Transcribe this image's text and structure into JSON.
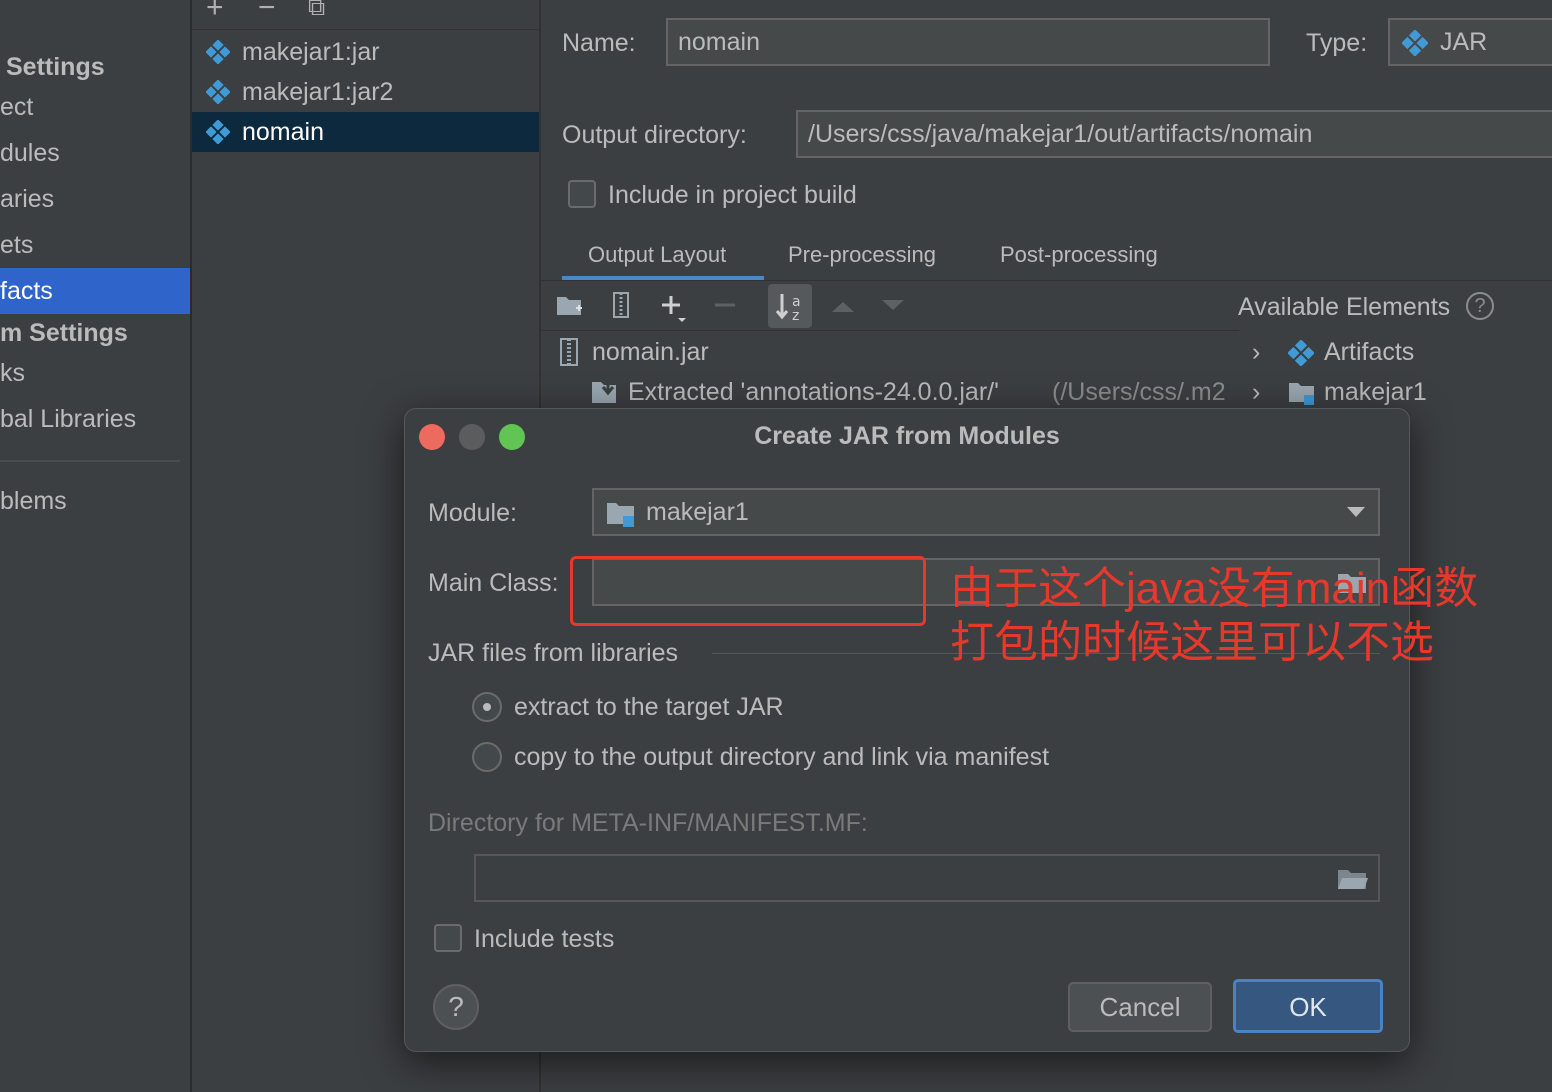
{
  "nav": {
    "items": [
      {
        "label": "Settings"
      },
      {
        "label": "ect"
      },
      {
        "label": "dules"
      },
      {
        "label": "aries"
      },
      {
        "label": "ets"
      },
      {
        "label": "facts"
      },
      {
        "label": "m Settings"
      },
      {
        "label": "ks"
      },
      {
        "label": "bal Libraries"
      },
      {
        "label": "blems"
      }
    ]
  },
  "artifacts": {
    "toolbar": {
      "add": "+",
      "remove": "−",
      "copy": "⧉"
    },
    "items": [
      {
        "label": "makejar1:jar"
      },
      {
        "label": "makejar1:jar2"
      },
      {
        "label": "nomain"
      }
    ]
  },
  "detail": {
    "name_label": "Name:",
    "name_value": "nomain",
    "type_label": "Type:",
    "type_value": "JAR",
    "output_dir_label": "Output directory:",
    "output_dir_value": "/Users/css/java/makejar1/out/artifacts/nomain",
    "include_build_label": "Include in project build",
    "tabs": [
      {
        "label": "Output Layout"
      },
      {
        "label": "Pre-processing"
      },
      {
        "label": "Post-processing"
      }
    ],
    "available_label": "Available Elements",
    "layout_tree": {
      "root": "nomain.jar",
      "child": "Extracted 'annotations-24.0.0.jar/'",
      "child_path": "(/Users/css/.m2"
    },
    "available_tree": [
      {
        "label": "Artifacts"
      },
      {
        "label": "makejar1"
      }
    ]
  },
  "dialog": {
    "title": "Create JAR from Modules",
    "module_label": "Module:",
    "module_value": "makejar1",
    "main_class_label": "Main Class:",
    "main_class_value": "",
    "jar_group_label": "JAR files from libraries",
    "radio_extract": "extract to the target JAR",
    "radio_copy": "copy to the output directory and link via manifest",
    "manifest_label": "Directory for META-INF/MANIFEST.MF:",
    "manifest_value": "",
    "include_tests_label": "Include tests",
    "help_label": "?",
    "cancel_label": "Cancel",
    "ok_label": "OK"
  },
  "annotation": {
    "line1": "由于这个java没有main函数",
    "line2": "打包的时候这里可以不选",
    "color": "#e6392b"
  },
  "colors": {
    "background": "#3c3f41",
    "selection": "#2f65ca",
    "list_selection": "#0d293e",
    "accent": "#4a88c7",
    "close": "#ed6a5e",
    "minimize_inactive": "#5a5c5e",
    "maximize": "#61c554",
    "artifact_icon": "#3f9ad6"
  }
}
